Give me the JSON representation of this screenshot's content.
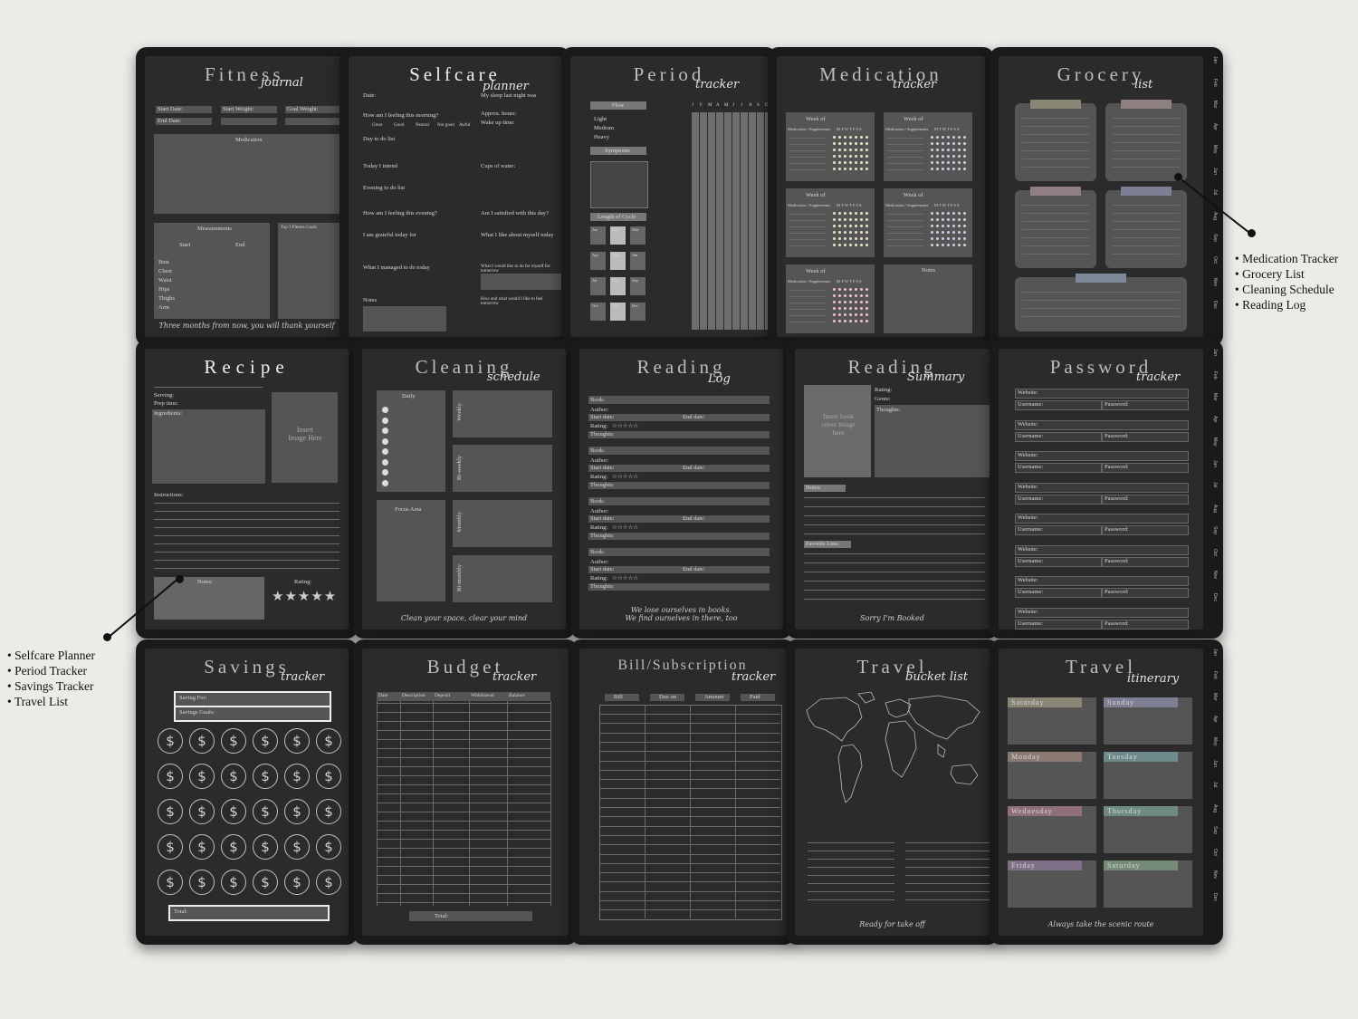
{
  "legend_right": [
    "Medication Tracker",
    "Grocery List",
    "Cleaning Schedule",
    "Reading Log"
  ],
  "legend_left": [
    "Selfcare Planner",
    "Period Tracker",
    "Savings Tracker",
    "Travel List"
  ],
  "months": [
    "Jan",
    "Feb",
    "Mar",
    "Apr",
    "May",
    "Jun",
    "Jul",
    "Aug",
    "Sep",
    "Oct",
    "Nov",
    "Dec"
  ],
  "pages": {
    "fitness": {
      "title": "Fitness",
      "script": "journal",
      "fields": [
        "Start Date:",
        "Start Weight:",
        "Goal Weight:",
        "End Date:"
      ],
      "medication": "Medication",
      "measurements": "Measurements",
      "start": "Start",
      "end": "End",
      "rows": [
        "Bust",
        "Chest",
        "Waist",
        "Hips",
        "Thighs",
        "Arm"
      ],
      "top": "Top 3 Fitness Goals",
      "footer": "Three months from now, you will thank yourself"
    },
    "selfcare": {
      "title": "Selfcare",
      "script": "planner",
      "date": "Date:",
      "sleep": "My sleep last night was",
      "feeling_morning": "How am I feeling this morning?",
      "moods": [
        "Great",
        "Good",
        "Neutral",
        "Not good",
        "Awful"
      ],
      "approx": "Approx. hours:",
      "wake": "Wake up time:",
      "todo": "Day to do list",
      "focus": "Today I intend",
      "cups": "Cups of water:",
      "evening": "Evening to do list",
      "feeling_evening": "How am I feeling this evening?",
      "fulfilled": "Am I satisfied with this day?",
      "grateful": "I am grateful today for",
      "like": "What I like about myself today",
      "managed": "What I managed to do today",
      "better": "What I would like to do for myself for tomorrow",
      "notes": "Notes",
      "words": "How and what would I like to feel tomorrow"
    },
    "period": {
      "title": "Period",
      "script": "tracker",
      "flow": "Flow",
      "levels": [
        "Light",
        "Medium",
        "Heavy"
      ],
      "symptoms": "Symptoms",
      "cycle": "Length of Cycle",
      "months_grid": [
        "Jan",
        "Feb",
        "Mar",
        "Apr",
        "May",
        "Jun",
        "Jul",
        "Aug",
        "Sep",
        "Oct",
        "Nov",
        "Dec"
      ],
      "cols": [
        "J",
        "F",
        "M",
        "A",
        "M",
        "J",
        "J",
        "A",
        "S",
        "O",
        "N",
        "D"
      ]
    },
    "medication": {
      "title": "Medication",
      "script": "tracker",
      "week": "Week of",
      "med": "Medication / Supplements",
      "days": "M T W T F S S",
      "notes": "Notes"
    },
    "grocery": {
      "title": "Grocery",
      "script": "list"
    },
    "recipe": {
      "title": "Recipe",
      "serving": "Serving:",
      "prep": "Prep time:",
      "ingredients": "Ingredients:",
      "image": "Insert Image Here",
      "instructions": "Instructions:",
      "notes": "Notes:",
      "rating": "Rating:",
      "stars": "★★★★★"
    },
    "cleaning": {
      "title": "Cleaning",
      "script": "schedule",
      "daily": "Daily",
      "weekly": "Weekly",
      "biweekly": "Bi-weekly",
      "monthly": "Monthly",
      "bimonthly": "Bi-monthly",
      "focus": "Focus Area",
      "footer": "Clean your space, clear your mind"
    },
    "reading_log": {
      "title": "Reading",
      "script": "Log",
      "book": "Book:",
      "author": "Author:",
      "start": "Start date:",
      "end": "End date:",
      "rating": "Rating:",
      "thoughts": "Thoughts:",
      "stars": "☆☆☆☆☆",
      "footer": "We lose ourselves in books. We find ourselves in there, too"
    },
    "reading_summary": {
      "title": "Reading",
      "script": "Summary",
      "cover": "Insert book cover image here",
      "rating": "Rating:",
      "genre": "Genre:",
      "thoughts": "Thoughts:",
      "notes": "Notes:",
      "fav": "Favorite Line:",
      "footer": "Sorry I'm Booked"
    },
    "password": {
      "title": "Password",
      "script": "tracker",
      "website": "Website:",
      "username": "Username:",
      "password": "Password:"
    },
    "savings": {
      "title": "Savings",
      "script": "tracker",
      "for": "Saving For:",
      "goals": "Savings Goals:",
      "total": "Total:",
      "symbol": "$"
    },
    "budget": {
      "title": "Budget",
      "script": "tracker",
      "cols": [
        "Date",
        "Description",
        "Deposit",
        "Withdrawal",
        "Balance"
      ],
      "total": "Total:"
    },
    "bills": {
      "title": "Bill/Subscription",
      "script": "tracker",
      "cols": [
        "Bill",
        "Due on",
        "Amount",
        "Paid"
      ]
    },
    "bucket": {
      "title": "Travel",
      "script": "bucket list",
      "footer": "Ready for take off"
    },
    "itinerary": {
      "title": "Travel",
      "script": "itinerary",
      "days": [
        "Saturday",
        "Sunday",
        "Monday",
        "Tuesday",
        "Wednesday",
        "Thursday",
        "Friday",
        "Saturday"
      ],
      "footer": "Always take the scenic route"
    }
  }
}
